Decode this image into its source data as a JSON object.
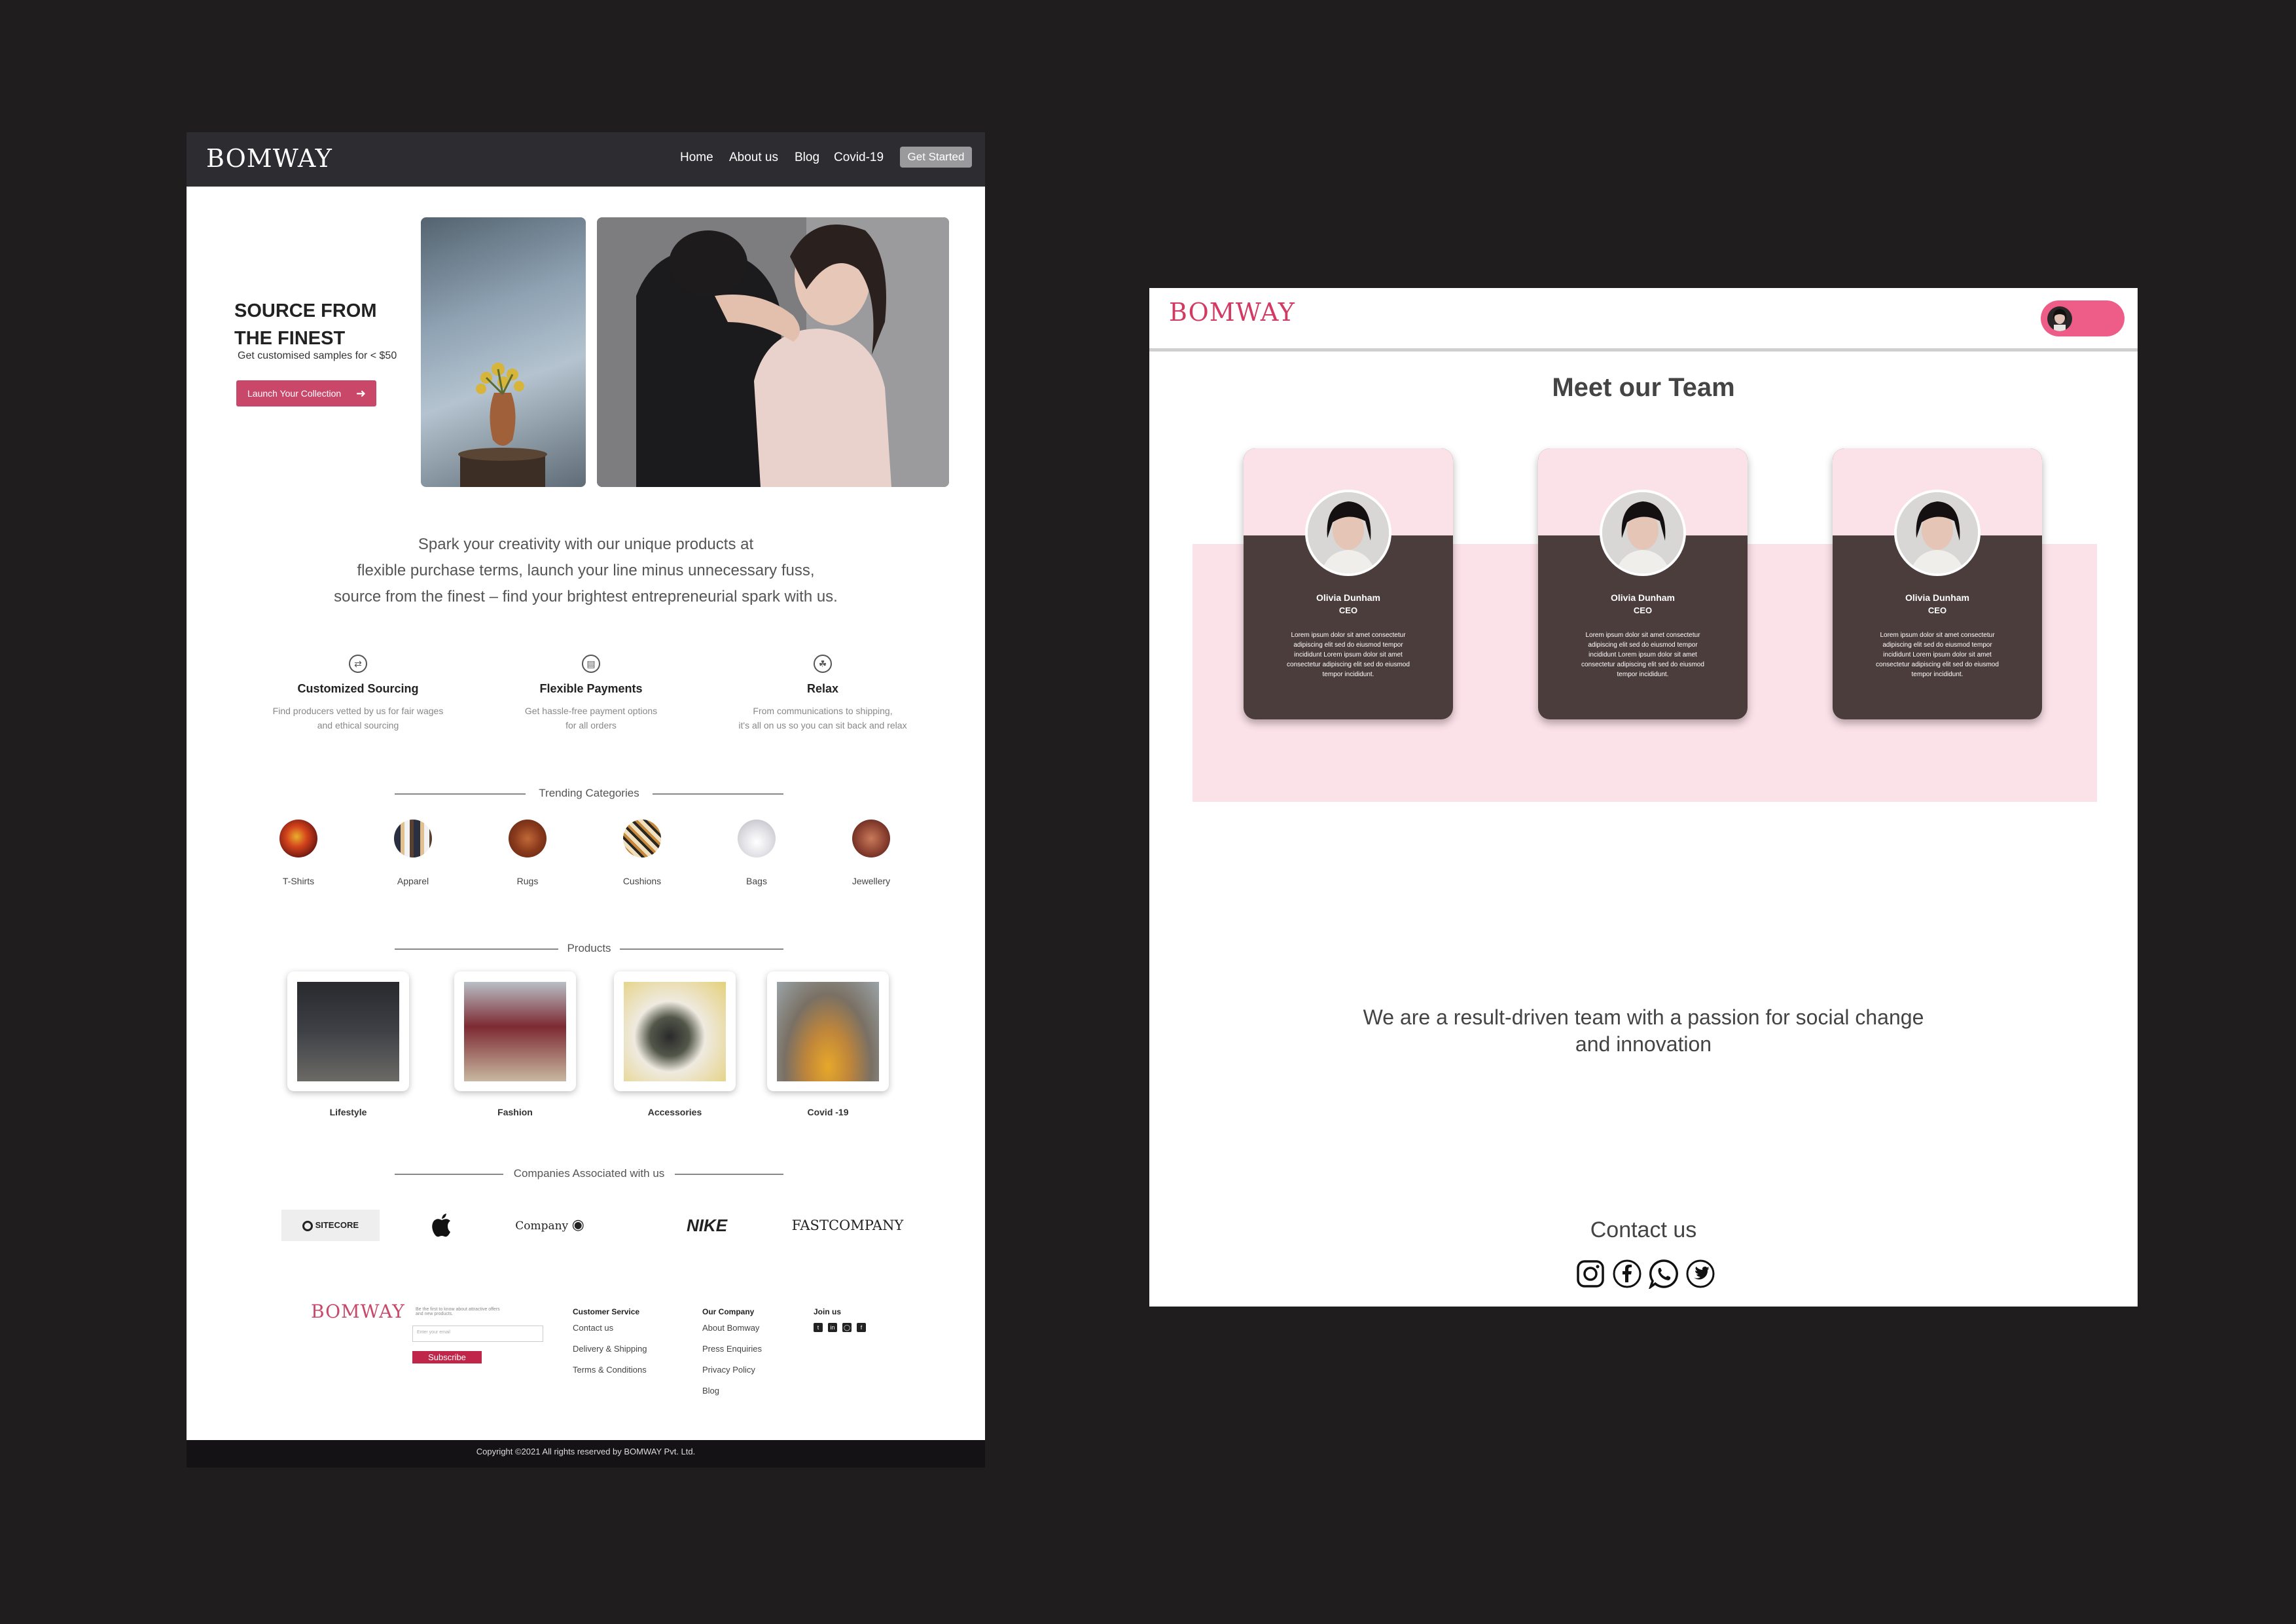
{
  "left_page": {
    "nav": {
      "logo": "BOMWAY",
      "links": [
        "Home",
        "About us",
        "Blog",
        "Covid-19"
      ],
      "cta": "Get Started"
    },
    "hero": {
      "title_line1": "SOURCE  FROM",
      "title_line2": "THE FINEST",
      "subtitle": "Get customised samples for < $50",
      "cta": "Launch Your Collection"
    },
    "intro": {
      "line1": "Spark your creativity with our unique products at",
      "line2": "flexible purchase terms, launch your line minus unnecessary fuss,",
      "line3": "source from the finest – find your brightest entrepreneurial spark with us."
    },
    "features": [
      {
        "icon": "exchange-icon",
        "title": "Customized Sourcing",
        "desc1": "Find producers vetted by us for fair wages",
        "desc2": "and ethical sourcing"
      },
      {
        "icon": "wallet-icon",
        "title": "Flexible Payments",
        "desc1": "Get hassle-free payment options",
        "desc2": "for all orders"
      },
      {
        "icon": "relax-icon",
        "title": "Relax",
        "desc1": "From communications to shipping,",
        "desc2": "it's all on us so you can sit back and relax"
      }
    ],
    "trending": {
      "title": "Trending Categories",
      "items": [
        "T-Shirts",
        "Apparel",
        "Rugs",
        "Cushions",
        "Bags",
        "Jewellery"
      ]
    },
    "products": {
      "title": "Products",
      "items": [
        "Lifestyle",
        "Fashion",
        "Accessories",
        "Covid -19"
      ]
    },
    "companies": {
      "title": "Companies Associated with us",
      "logos": [
        "SITECORE",
        "Company",
        "NIKE",
        "FASTCOMPANY"
      ]
    },
    "footer": {
      "logo": "BOMWAY",
      "newsletter_text": "Be the first to know about attractive offers and new products.",
      "email_placeholder": "Enter your email",
      "subscribe": "Subscribe",
      "customer_service": {
        "title": "Customer Service",
        "links": [
          "Contact us",
          "Delivery & Shipping",
          "Terms & Conditions"
        ]
      },
      "our_company": {
        "title": "Our Company",
        "links": [
          "About Bomway",
          "Press Enquiries",
          "Privacy Policy",
          "Blog"
        ]
      },
      "join_us": {
        "title": "Join us"
      },
      "copyright": "Copyright ©2021 All rights reserved by BOMWAY Pvt. Ltd."
    }
  },
  "right_page": {
    "logo": "BOMWAY",
    "team_title": "Meet our Team",
    "members": [
      {
        "name": "Olivia Dunham",
        "role": "CEO",
        "bio": "Lorem ipsum dolor sit amet consectetur adipiscing elit sed do eiusmod tempor incididunt Lorem ipsum dolor sit amet consectetur adipiscing elit sed do eiusmod tempor incididunt."
      },
      {
        "name": "Olivia Dunham",
        "role": "CEO",
        "bio": "Lorem ipsum dolor sit amet consectetur adipiscing elit sed do eiusmod tempor incididunt Lorem ipsum dolor sit amet consectetur adipiscing elit sed do eiusmod tempor incididunt."
      },
      {
        "name": "Olivia Dunham",
        "role": "CEO",
        "bio": "Lorem ipsum dolor sit amet consectetur adipiscing elit sed do eiusmod tempor incididunt Lorem ipsum dolor sit amet consectetur adipiscing elit sed do eiusmod tempor incididunt."
      }
    ],
    "mission_line1": "We are a result-driven team with a passion for social change",
    "mission_line2": "and innovation",
    "contact_title": "Contact us",
    "social_icons": [
      "instagram-icon",
      "facebook-icon",
      "whatsapp-icon",
      "twitter-icon"
    ]
  },
  "colors": {
    "background": "#1f1d1e",
    "nav_dark": "#2d2c30",
    "brand_pink": "#c9486a",
    "pink_light": "#fbe1e8",
    "card_brown": "#4a3d3c",
    "pill_pink": "#ee5d88"
  }
}
